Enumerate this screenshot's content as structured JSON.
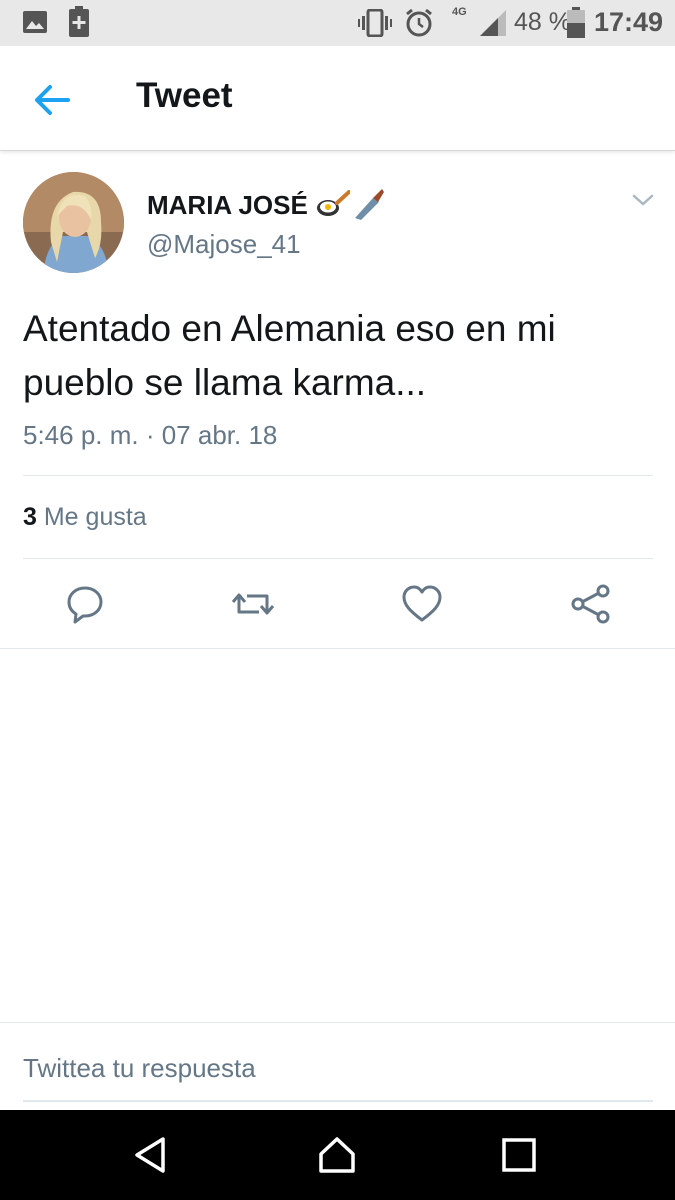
{
  "status_bar": {
    "battery_percent": "48 %",
    "time": "17:49",
    "network": "4G",
    "icons": [
      "image-icon",
      "battery-saver-icon",
      "vibrate-icon",
      "alarm-icon",
      "signal-icon",
      "battery-icon"
    ]
  },
  "app_bar": {
    "title": "Tweet",
    "back_icon": "arrow-left-icon",
    "accent_color": "#1da1f2"
  },
  "tweet": {
    "author_name": "MARIA JOSÉ",
    "author_handle": "@Majose_41",
    "name_emojis": [
      "frying-pan-emoji",
      "kitchen-knife-emoji"
    ],
    "text": "Atentado en Alemania eso en mi pueblo se llama karma...",
    "timestamp": "5:46 p. m. · 07 abr. 18",
    "likes_count": "3",
    "likes_label": "Me gusta",
    "actions": [
      "reply-icon",
      "retweet-icon",
      "like-icon",
      "share-icon"
    ]
  },
  "reply": {
    "placeholder": "Twittea tu respuesta"
  },
  "nav_bar": {
    "buttons": [
      "nav-back-icon",
      "nav-home-icon",
      "nav-recents-icon"
    ]
  }
}
